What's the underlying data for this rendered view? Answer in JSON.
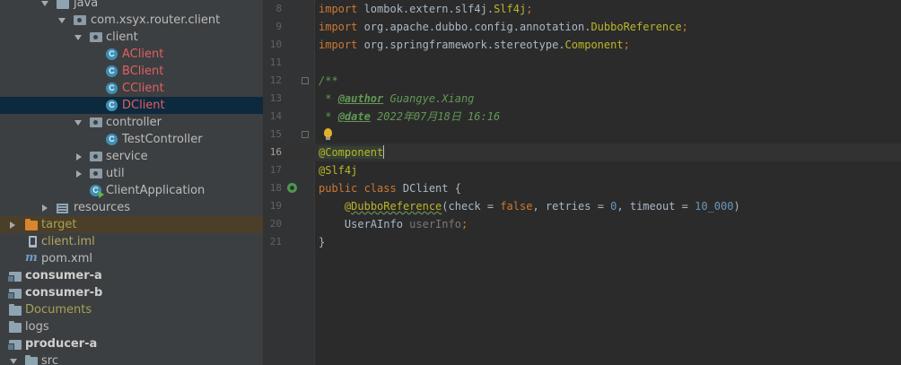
{
  "project_tree": {
    "items": [
      {
        "label": "java",
        "icon": "folder-icon",
        "expanded": true
      },
      {
        "label": "com.xsyx.router.client",
        "icon": "package-icon",
        "expanded": true
      },
      {
        "label": "client",
        "icon": "package-icon",
        "expanded": true
      },
      {
        "label": "AClient",
        "icon": "class-icon",
        "status": "new"
      },
      {
        "label": "BClient",
        "icon": "class-icon",
        "status": "new"
      },
      {
        "label": "CClient",
        "icon": "class-icon",
        "status": "new"
      },
      {
        "label": "DClient",
        "icon": "class-icon",
        "status": "new",
        "selected": true
      },
      {
        "label": "controller",
        "icon": "package-icon",
        "expanded": true
      },
      {
        "label": "TestController",
        "icon": "class-icon"
      },
      {
        "label": "service",
        "icon": "package-icon",
        "expanded": false
      },
      {
        "label": "util",
        "icon": "package-icon",
        "expanded": false
      },
      {
        "label": "ClientApplication",
        "icon": "spring-boot-class-icon"
      },
      {
        "label": "resources",
        "icon": "resources-folder-icon",
        "expanded": false
      },
      {
        "label": "target",
        "icon": "excluded-folder-icon",
        "expanded": false
      },
      {
        "label": "client.iml",
        "icon": "iml-file-icon"
      },
      {
        "label": "pom.xml",
        "icon": "maven-icon"
      },
      {
        "label": "consumer-a",
        "icon": "module-icon"
      },
      {
        "label": "consumer-b",
        "icon": "module-icon"
      },
      {
        "label": "Documents",
        "icon": "folder-icon"
      },
      {
        "label": "logs",
        "icon": "folder-icon"
      },
      {
        "label": "producer-a",
        "icon": "module-icon"
      },
      {
        "label": "src",
        "icon": "folder-icon",
        "expanded": true
      }
    ]
  },
  "editor": {
    "lines": [
      {
        "num": "8",
        "parts": [
          {
            "t": "import",
            "c": "kw"
          },
          {
            "t": " lombok.extern.slf4j."
          },
          {
            "t": "Slf4j",
            "c": "ann"
          },
          {
            "t": ";",
            "c": "kw"
          }
        ]
      },
      {
        "num": "9",
        "parts": [
          {
            "t": "import",
            "c": "kw"
          },
          {
            "t": " org.apache.dubbo.config.annotation."
          },
          {
            "t": "DubboReference",
            "c": "ann"
          },
          {
            "t": ";",
            "c": "kw"
          }
        ]
      },
      {
        "num": "10",
        "parts": [
          {
            "t": "import",
            "c": "kw"
          },
          {
            "t": " org.springframework.stereotype."
          },
          {
            "t": "Component",
            "c": "ann"
          },
          {
            "t": ";",
            "c": "kw"
          }
        ]
      },
      {
        "num": "11",
        "parts": []
      },
      {
        "num": "12",
        "parts": [
          {
            "t": "/**",
            "c": "doc"
          }
        ]
      },
      {
        "num": "13",
        "parts": [
          {
            "t": " * ",
            "c": "doc"
          },
          {
            "t": "@author",
            "c": "tag"
          },
          {
            "t": " Guangye.Xiang",
            "c": "doc"
          }
        ]
      },
      {
        "num": "14",
        "parts": [
          {
            "t": " * ",
            "c": "doc"
          },
          {
            "t": "@date",
            "c": "tag"
          },
          {
            "t": " 2022年07月18日 16:16",
            "c": "doc"
          }
        ]
      },
      {
        "num": "15",
        "parts": [
          {
            "t": " */",
            "c": "doc"
          }
        ]
      },
      {
        "num": "16",
        "parts": [
          {
            "t": "@Component",
            "c": "ann boxed"
          },
          {
            "t": "",
            "c": "caret"
          }
        ]
      },
      {
        "num": "17",
        "parts": [
          {
            "t": "@Slf4j",
            "c": "ann"
          }
        ]
      },
      {
        "num": "18",
        "parts": [
          {
            "t": "public class",
            "c": "kw"
          },
          {
            "t": " DClient {"
          }
        ]
      },
      {
        "num": "19",
        "parts": [
          {
            "t": "    "
          },
          {
            "t": "@",
            "c": "ann"
          },
          {
            "t": "DubboReference",
            "c": "ann wavy"
          },
          {
            "t": "(check = "
          },
          {
            "t": "false",
            "c": "kw"
          },
          {
            "t": ", "
          },
          {
            "t": "retries = "
          },
          {
            "t": "0",
            "c": "num"
          },
          {
            "t": ", "
          },
          {
            "t": "timeout = "
          },
          {
            "t": "10_000",
            "c": "num"
          },
          {
            "t": ")"
          }
        ]
      },
      {
        "num": "20",
        "parts": [
          {
            "t": "    UserAInfo "
          },
          {
            "t": "userInfo",
            "c": "gray"
          },
          {
            "t": ";",
            "c": "kw"
          }
        ]
      },
      {
        "num": "21",
        "parts": [
          {
            "t": "}"
          }
        ]
      }
    ],
    "current_line": "16"
  }
}
